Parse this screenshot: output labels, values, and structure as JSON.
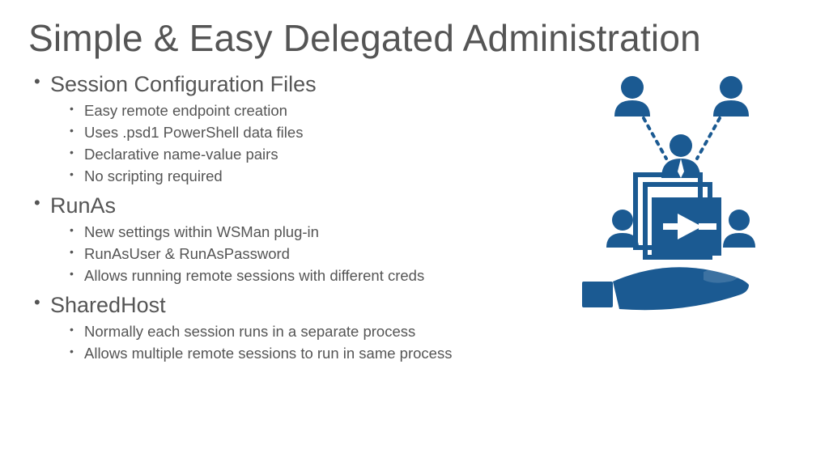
{
  "title": "Simple & Easy Delegated Administration",
  "sections": [
    {
      "heading": "Session Configuration Files",
      "items": [
        "Easy remote endpoint creation",
        "Uses .psd1 PowerShell data files",
        "Declarative name-value pairs",
        "No scripting required"
      ]
    },
    {
      "heading": "RunAs",
      "items": [
        "New settings within WSMan plug-in",
        "RunAsUser & RunAsPassword",
        "Allows running remote sessions with different creds"
      ]
    },
    {
      "heading": "SharedHost",
      "items": [
        "Normally each session runs in a separate process",
        "Allows multiple remote sessions to run in same process"
      ]
    }
  ],
  "colors": {
    "icon": "#1b5a92",
    "text": "#555555"
  }
}
